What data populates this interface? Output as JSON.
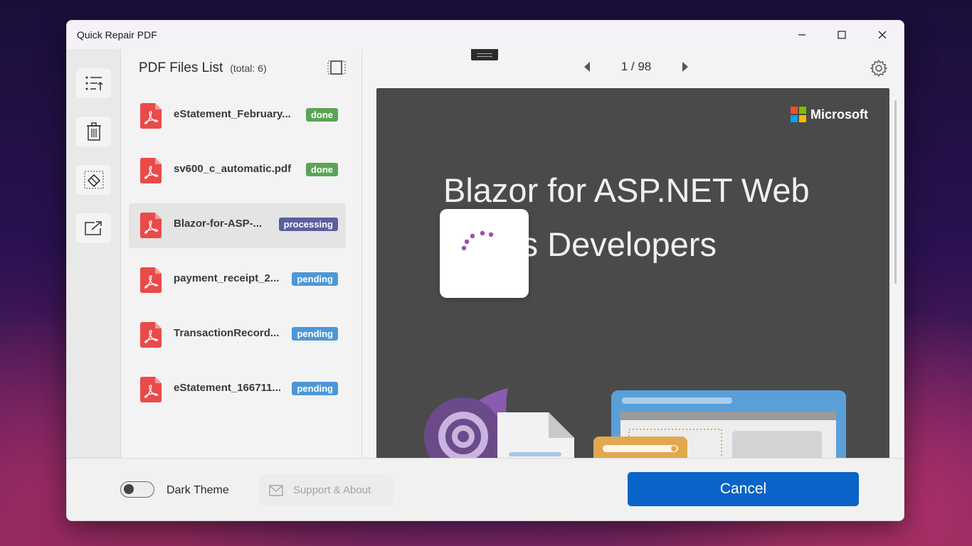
{
  "window": {
    "title": "Quick Repair PDF",
    "controls": [
      "minimize-icon",
      "maximize-icon",
      "close-icon"
    ]
  },
  "toolbar": {
    "buttons": [
      {
        "name": "sort-list-icon"
      },
      {
        "name": "trash-icon"
      },
      {
        "name": "eraser-icon"
      },
      {
        "name": "export-icon"
      }
    ]
  },
  "file_list": {
    "title": "PDF Files List",
    "total": "(total: 6)",
    "items": [
      {
        "name": "eStatement_February...",
        "status": "done",
        "color": "#5aa457"
      },
      {
        "name": "sv600_c_automatic.pdf",
        "status": "done",
        "color": "#5aa457"
      },
      {
        "name": "Blazor-for-ASP-...",
        "status": "processing",
        "color": "#5b5fa0"
      },
      {
        "name": "payment_receipt_2...",
        "status": "pending",
        "color": "#4d97d6"
      },
      {
        "name": "TransactionRecord...",
        "status": "pending",
        "color": "#4d97d6"
      },
      {
        "name": "eStatement_166711...",
        "status": "pending",
        "color": "#4d97d6"
      }
    ]
  },
  "viewer": {
    "page_indicator": "1 / 98",
    "brand": "Microsoft",
    "document_title": "Blazor for ASP.NET Web Forms Developers"
  },
  "footer": {
    "dark_theme_label": "Dark Theme",
    "dark_theme_on": false,
    "support_label": "Support & About",
    "cancel_label": "Cancel"
  },
  "colors": {
    "accent": "#0a63c6",
    "pdf_red": "#e94a4a",
    "spinner": "#9b4fb5"
  }
}
